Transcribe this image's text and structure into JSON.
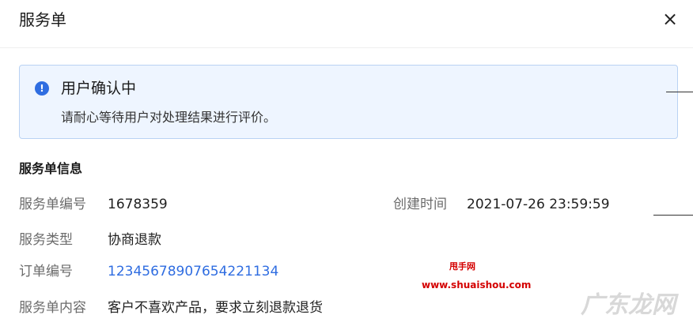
{
  "dialog": {
    "title": "服务单",
    "close_icon": "×"
  },
  "notice": {
    "icon": "!",
    "title": "用户确认中",
    "message": "请耐心等待用户对处理结果进行评价。"
  },
  "info": {
    "section_title": "服务单信息",
    "service_id_label": "服务单编号",
    "service_id_value": "1678359",
    "created_label": "创建时间",
    "created_value": "2021-07-26 23:59:59",
    "type_label": "服务类型",
    "type_value": "协商退款",
    "order_label": "订单编号",
    "order_value": "12345678907654221134",
    "content_label": "服务单内容",
    "content_value": "客户不喜欢产品，要求立刻退款退货"
  },
  "watermark": {
    "small": "甩手网",
    "url": "www.shuaishou.com",
    "brand": "广东龙网"
  },
  "colors": {
    "accent": "#2f6de1",
    "notice_bg": "#eef5ff",
    "notice_border": "#b9d2f3"
  }
}
